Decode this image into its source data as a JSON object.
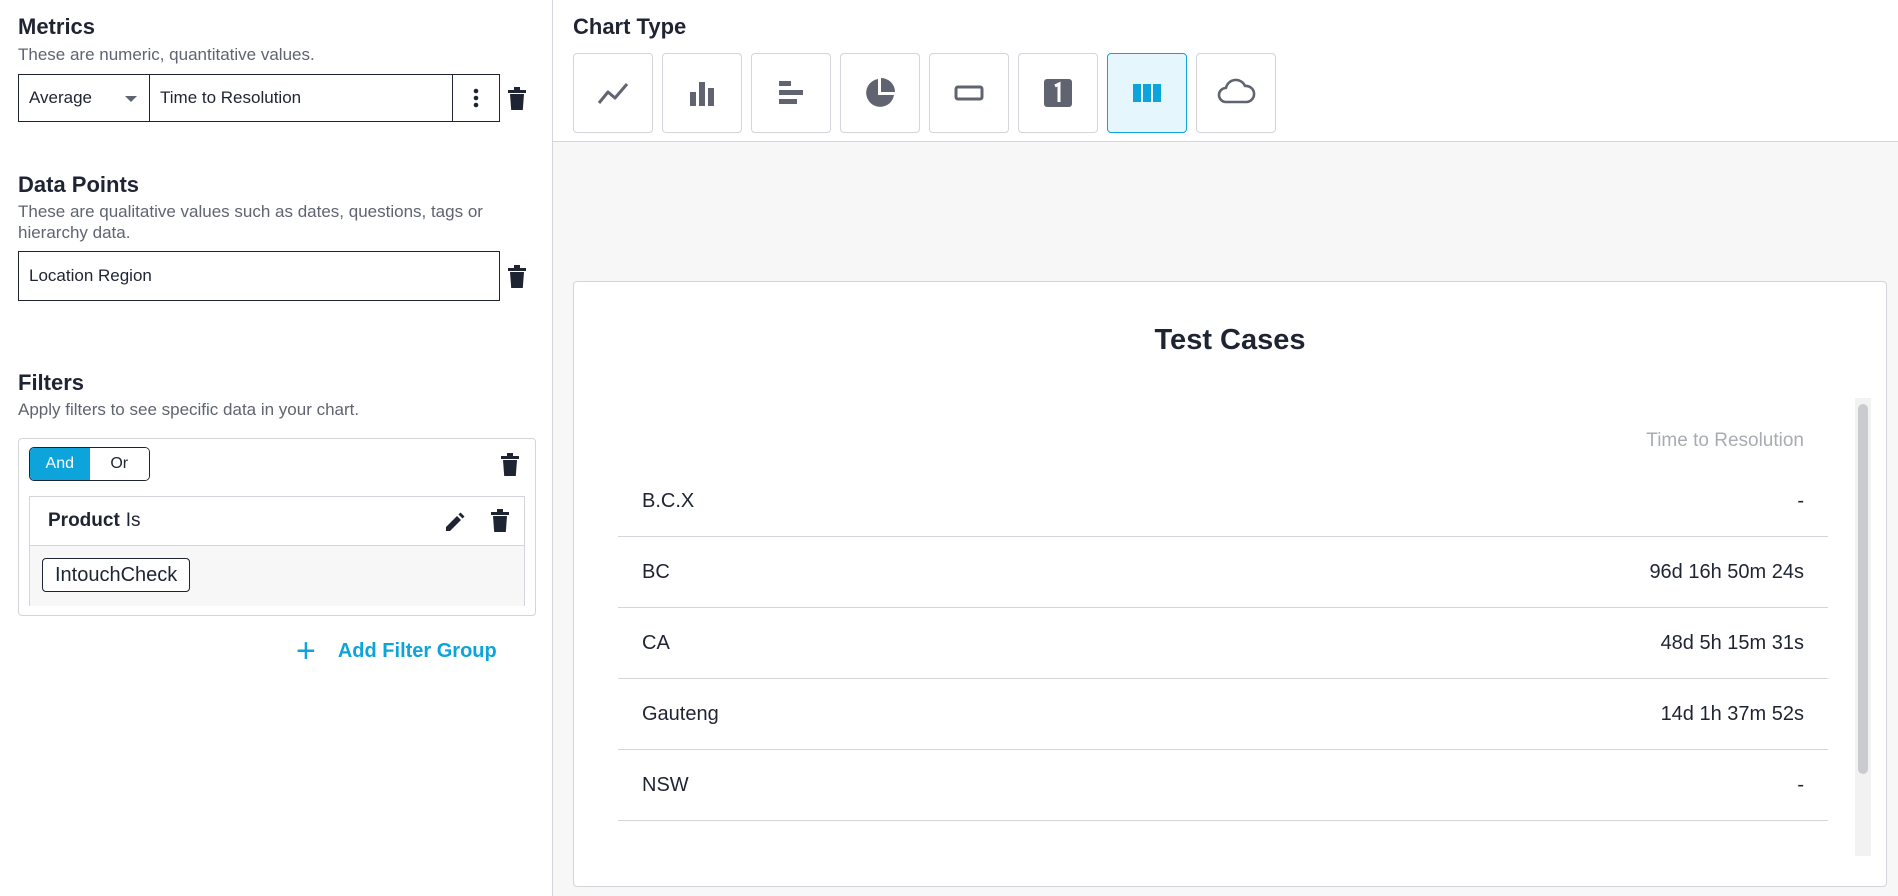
{
  "metrics": {
    "title": "Metrics",
    "description": "These are numeric, quantitative values.",
    "aggregation": "Average",
    "field": "Time to Resolution"
  },
  "data_points": {
    "title": "Data Points",
    "description_line1": "These are qualitative values such as dates, questions, tags or",
    "description_line2": "hierarchy data.",
    "value": "Location Region"
  },
  "filters": {
    "title": "Filters",
    "description": "Apply filters to see specific data in your chart.",
    "toggle": {
      "and": "And",
      "or": "Or",
      "selected": "And"
    },
    "filter": {
      "field": "Product",
      "operator": "Is",
      "value": "IntouchCheck"
    },
    "add_group": "Add Filter Group"
  },
  "chart_type": {
    "title": "Chart Type",
    "options": [
      "line-chart-icon",
      "column-chart-icon",
      "bar-chart-icon",
      "pie-chart-icon",
      "box-icon",
      "number-icon",
      "table-icon",
      "word-cloud-icon"
    ],
    "selected": "table-icon"
  },
  "colors": {
    "accent": "#0da4dc",
    "text": "#1f2433",
    "border": "#d3d5da"
  },
  "chart_data": {
    "type": "table",
    "title": "Test Cases",
    "columns": [
      "",
      "Time to Resolution"
    ],
    "rows": [
      [
        "B.C.X",
        "-"
      ],
      [
        "BC",
        "96d 16h 50m 24s"
      ],
      [
        "CA",
        "48d 5h 15m 31s"
      ],
      [
        "Gauteng",
        "14d 1h 37m 52s"
      ],
      [
        "NSW",
        "-"
      ]
    ]
  }
}
